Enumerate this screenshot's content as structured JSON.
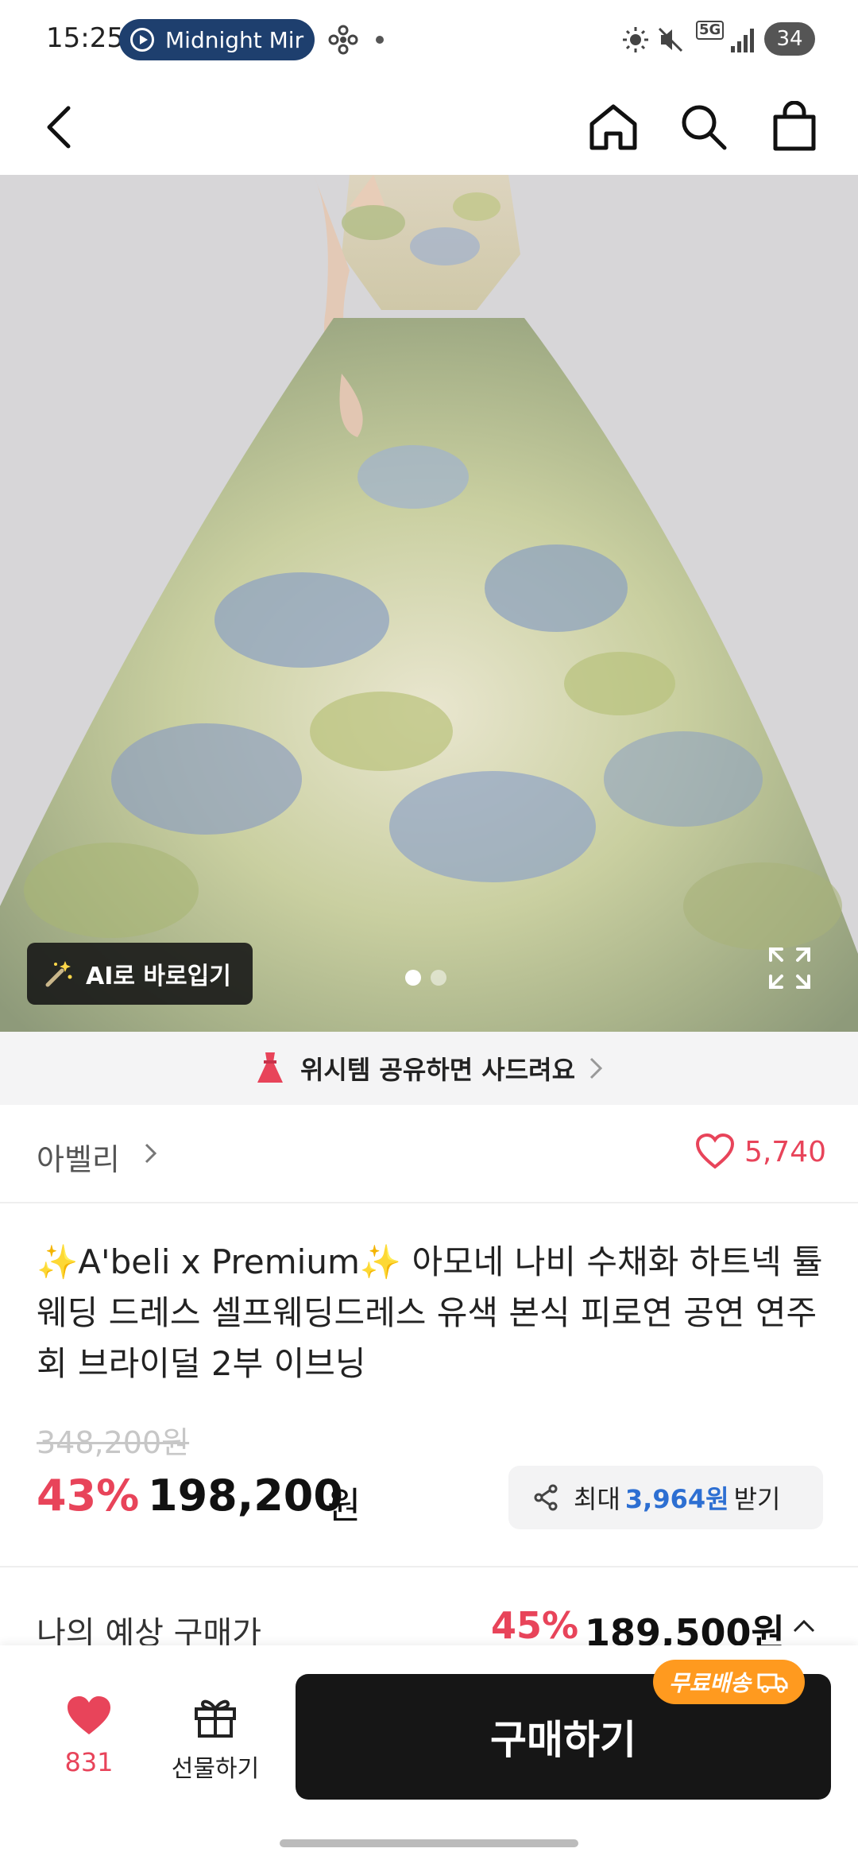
{
  "status_bar": {
    "time": "15:25",
    "media_title": "Midnight Mir",
    "battery": "34",
    "network": "5G"
  },
  "nav": {
    "back_icon": "back-arrow-icon",
    "home_icon": "home-icon",
    "search_icon": "search-icon",
    "cart_icon": "shopping-bag-icon"
  },
  "hero": {
    "ai_button_label": "AI로 바로입기",
    "page_count": 2,
    "active_page": 1
  },
  "wish_banner": {
    "text": "위시템 공유하면 사드려요"
  },
  "brand": {
    "name": "아벨리",
    "like_count": "5,740"
  },
  "product": {
    "title": "✨A'beli x Premium✨ 아모네 나비 수채화 하트넥 튤 웨딩 드레스 셀프웨딩드레스 유색 본식 피로연 공연 연주회 브라이덜 2부 이브닝",
    "original_price": "348,200원",
    "discount": "43%",
    "price": "198,200",
    "currency": "원",
    "reward": {
      "prefix": "최대",
      "amount": "3,964원",
      "suffix": "받기"
    }
  },
  "expected": {
    "label": "나의 예상 구매가",
    "discount": "45%",
    "price": "189,500원"
  },
  "bottom_bar": {
    "like_count": "831",
    "gift_label": "선물하기",
    "buy_label": "구매하기",
    "free_shipping": "무료배송"
  },
  "colors": {
    "accent": "#e8445a",
    "reward_blue": "#2d6fd2",
    "shipping_orange": "#ff9a1f",
    "buy_button": "#161616"
  }
}
